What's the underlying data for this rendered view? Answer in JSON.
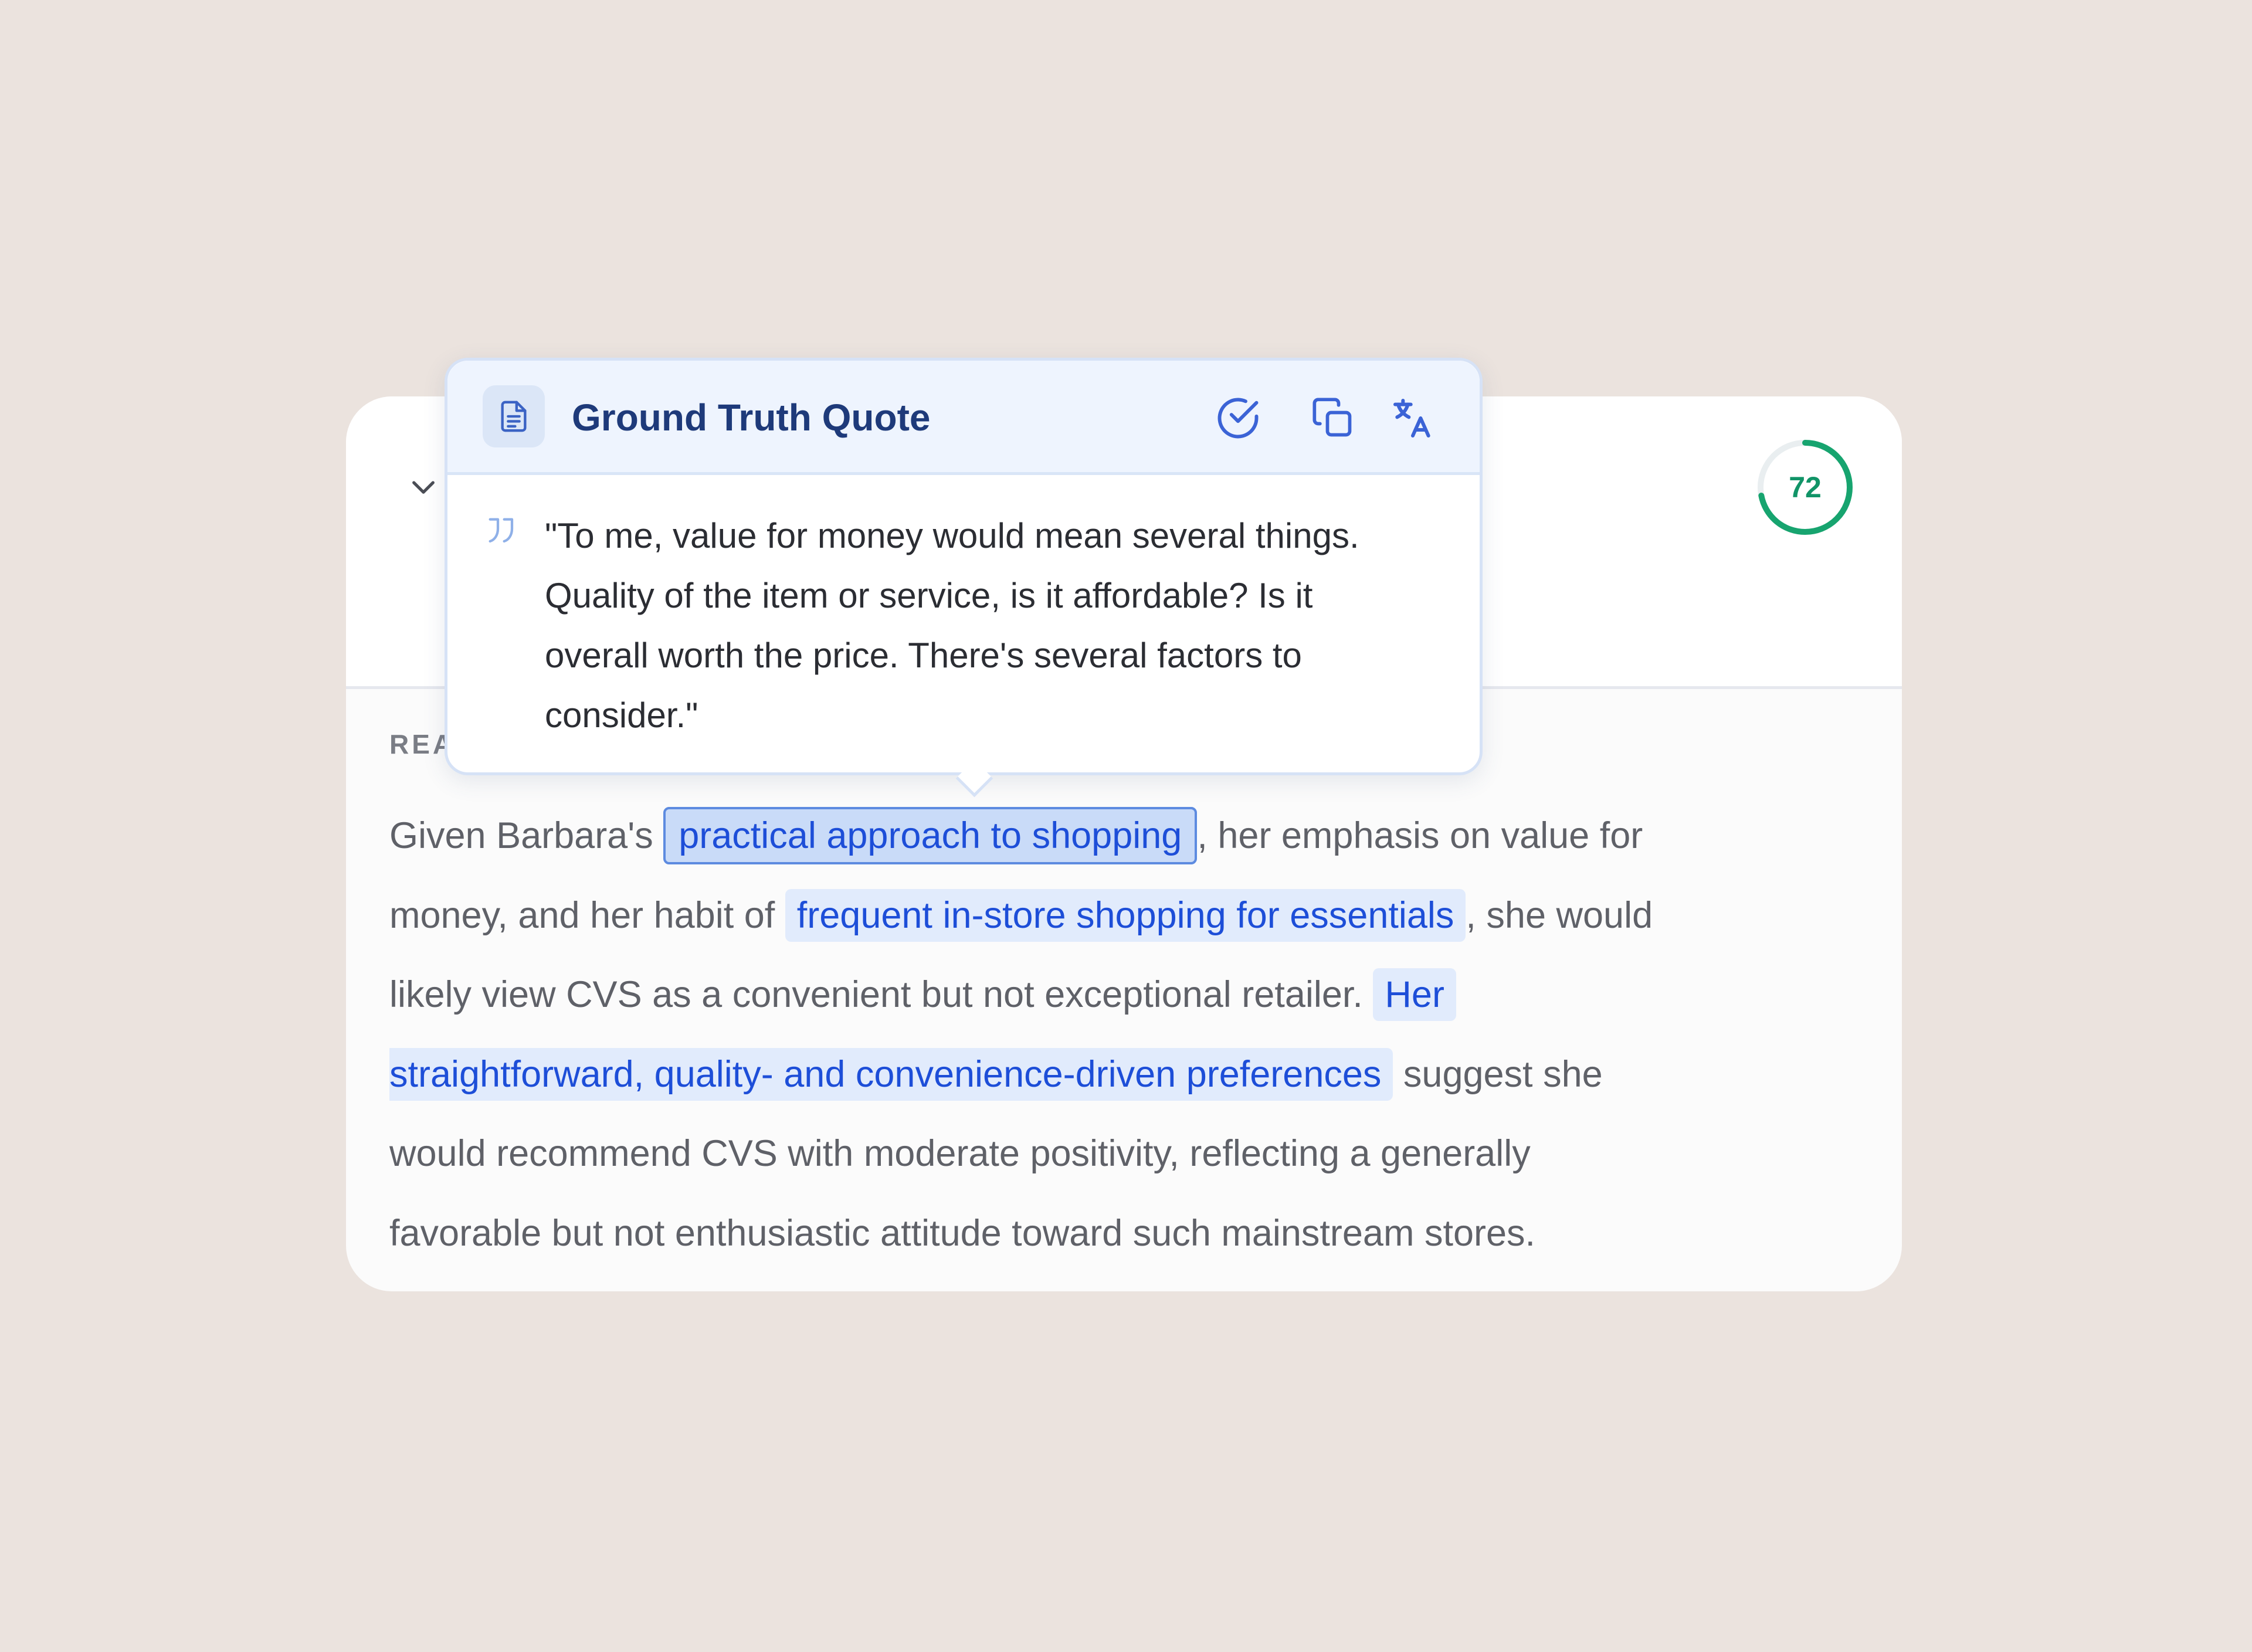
{
  "card": {
    "section_label": "REASONING",
    "score": 72,
    "score_progress": 0.72,
    "colors": {
      "score": "#119467",
      "highlight_text": "#1d4ed8",
      "highlight_bg": "#e1ebfc",
      "background": "#ebe3de"
    },
    "reasoning_lines": [
      [
        {
          "text": "Given Barbara's ",
          "type": "plain"
        },
        {
          "text": "practical approach to shopping",
          "type": "highlight-active"
        },
        {
          "text": ", her emphasis on value for",
          "type": "plain"
        }
      ],
      [
        {
          "text": "money, and her habit of ",
          "type": "plain"
        },
        {
          "text": "frequent in-store shopping for essentials",
          "type": "highlight"
        },
        {
          "text": ", she would",
          "type": "plain"
        }
      ],
      [
        {
          "text": "likely view CVS as a convenient but not exceptional retailer. ",
          "type": "plain"
        },
        {
          "text": "Her",
          "type": "highlight"
        }
      ],
      [
        {
          "text": "straightforward, quality- and convenience-driven preferences",
          "type": "highlight-start"
        },
        {
          "text": " suggest she",
          "type": "plain"
        }
      ],
      [
        {
          "text": "would recommend CVS with moderate positivity, reflecting a generally",
          "type": "plain"
        }
      ],
      [
        {
          "text": "favorable but not enthusiastic attitude toward such mainstream stores.",
          "type": "plain"
        }
      ]
    ]
  },
  "popover": {
    "title": "Ground Truth Quote",
    "icons": {
      "document": "document-icon",
      "verify": "check-circle-icon",
      "copy": "copy-icon",
      "translate": "translate-icon",
      "quote": "quote-mark-icon"
    },
    "quote_lines": [
      "\"To me, value for money would mean several things.",
      "Quality of the item or service, is it affordable? Is it",
      "overall worth the price. There's several factors to",
      "consider.\""
    ]
  }
}
